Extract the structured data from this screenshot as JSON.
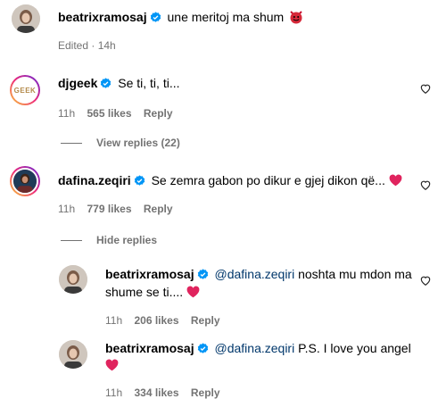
{
  "caption": {
    "username": "beatrixramosaj",
    "text": "une meritoj ma shum",
    "emoji_icon": "smiling-devil-icon",
    "edited": "Edited · 14h"
  },
  "comments": [
    {
      "username": "djgeek",
      "text": "Se ti, ti, ti...",
      "time": "11h",
      "likes": "565 likes",
      "reply": "Reply",
      "toggle": "View replies (22)",
      "avatar_label": "GEEK"
    },
    {
      "username": "dafina.zeqiri",
      "text": "Se zemra gabon po dikur e gjej dikon që...",
      "time": "11h",
      "likes": "779 likes",
      "reply": "Reply",
      "toggle": "Hide replies"
    }
  ],
  "replies": [
    {
      "username": "beatrixramosaj",
      "mention": "@dafina.zeqiri",
      "text_line1": "noshta mu mdon ma",
      "text_line2": "shume se ti....",
      "time": "11h",
      "likes": "206 likes",
      "reply": "Reply"
    },
    {
      "username": "beatrixramosaj",
      "mention": "@dafina.zeqiri",
      "text_line1": "P.S. I love you angel",
      "time": "11h",
      "likes": "334 likes",
      "reply": "Reply"
    }
  ],
  "colors": {
    "verified": "#0095f6",
    "heart": "#e0245e",
    "meta": "#737373",
    "mention": "#00376b"
  }
}
